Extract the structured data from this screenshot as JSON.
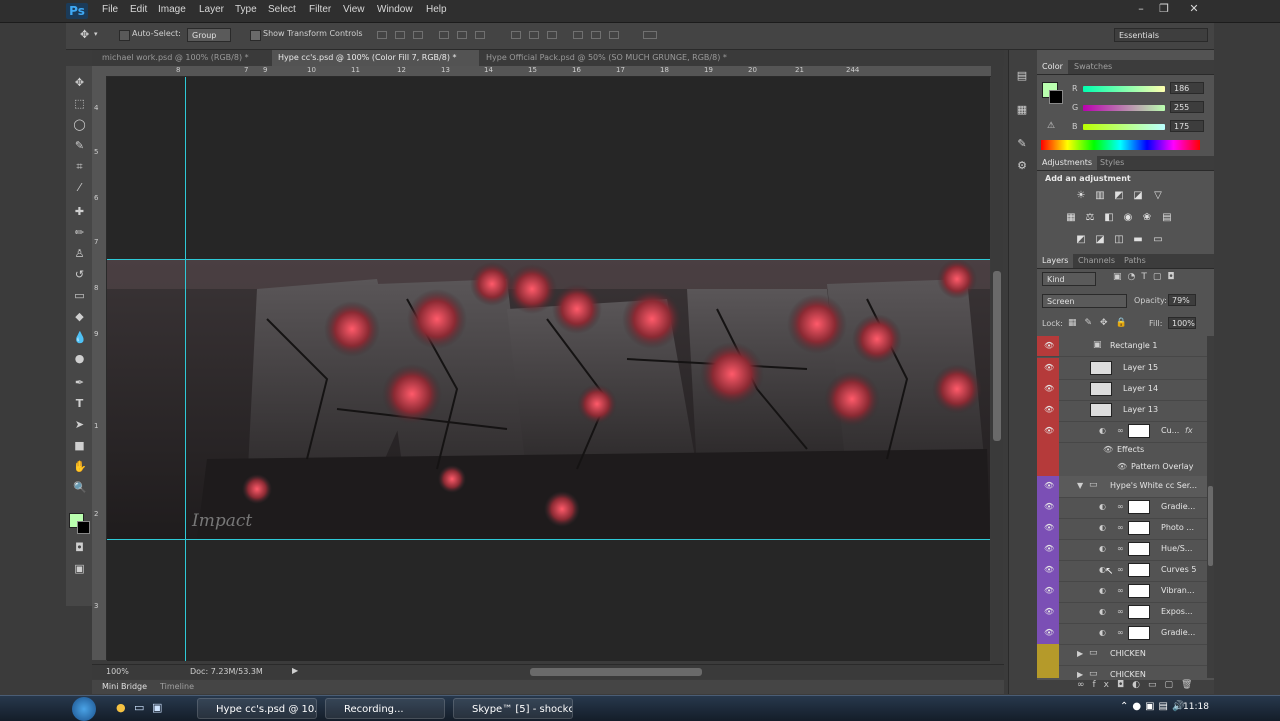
{
  "app": {
    "logo": "Ps"
  },
  "menu": [
    "File",
    "Edit",
    "Image",
    "Layer",
    "Type",
    "Select",
    "Filter",
    "View",
    "Window",
    "Help"
  ],
  "window_controls": {
    "minimize": "–",
    "restore": "❐",
    "close": "✕"
  },
  "options_bar": {
    "auto_select_label": "Auto-Select:",
    "auto_select_value": "Group",
    "show_transform_label": "Show Transform Controls",
    "workspace": "Essentials"
  },
  "doc_tabs": [
    {
      "label": "michael work.psd @ 100% (RGB/8) *",
      "active": false
    },
    {
      "label": "Hype cc's.psd @ 100% (Color Fill 7, RGB/8) *",
      "active": true
    },
    {
      "label": "Hype Official Pack.psd @ 50% (SO MUCH GRUNGE, RGB/8) *",
      "active": false
    }
  ],
  "ruler_top": [
    "8",
    "7",
    "9",
    "10",
    "11",
    "12",
    "13",
    "14",
    "15",
    "16",
    "17",
    "18",
    "19",
    "20",
    "21",
    "244"
  ],
  "ruler_left": [
    "4",
    "5",
    "6",
    "7",
    "8",
    "9",
    "1",
    "2",
    "3"
  ],
  "canvas": {
    "watermark": "Impact",
    "background_color": "#262626"
  },
  "status": {
    "zoom": "100%",
    "doc": "Doc: 7.23M/53.3M"
  },
  "bottom_tabs": [
    "Mini Bridge",
    "Timeline"
  ],
  "color_panel": {
    "tabs": [
      "Color",
      "Swatches"
    ],
    "foreground": "#baffaf",
    "r": {
      "label": "R",
      "value": "186"
    },
    "g": {
      "label": "G",
      "value": "255"
    },
    "b": {
      "label": "B",
      "value": "175"
    }
  },
  "adjustments_panel": {
    "tabs": [
      "Adjustments",
      "Styles"
    ],
    "heading": "Add an adjustment"
  },
  "layers_panel": {
    "tabs": [
      "Layers",
      "Channels",
      "Paths"
    ],
    "filter": "Kind",
    "blend_mode": "Screen",
    "opacity_label": "Opacity:",
    "opacity": "79%",
    "lock_label": "Lock:",
    "fill_label": "Fill:",
    "fill": "100%",
    "rows": [
      {
        "name": "Rectangle 1",
        "color": "#b53a3a"
      },
      {
        "name": "Layer 15",
        "color": "#b53a3a"
      },
      {
        "name": "Layer 14",
        "color": "#b53a3a"
      },
      {
        "name": "Layer 13",
        "color": "#b53a3a"
      },
      {
        "name": "Cu...",
        "color": "#b53a3a"
      },
      {
        "name": "Effects",
        "color": "#b53a3a"
      },
      {
        "name": "Pattern Overlay",
        "color": "#b53a3a"
      },
      {
        "name": "Hype's White cc Ser...",
        "color": "#7b4fb5"
      },
      {
        "name": "Gradie...",
        "color": "#7b4fb5"
      },
      {
        "name": "Photo ...",
        "color": "#7b4fb5"
      },
      {
        "name": "Hue/S...",
        "color": "#7b4fb5"
      },
      {
        "name": "Curves 5",
        "color": "#7b4fb5"
      },
      {
        "name": "Vibran...",
        "color": "#7b4fb5"
      },
      {
        "name": "Expos...",
        "color": "#7b4fb5"
      },
      {
        "name": "Gradie...",
        "color": "#7b4fb5"
      },
      {
        "name": "CHICKEN",
        "color": "#b59a2a"
      },
      {
        "name": "CHICKEN",
        "color": "#b59a2a"
      }
    ]
  },
  "taskbar": {
    "items": [
      "Hype cc's.psd @ 10...",
      "Recording...",
      "Skype™ [5] - shockc..."
    ],
    "clock": "11:18"
  }
}
